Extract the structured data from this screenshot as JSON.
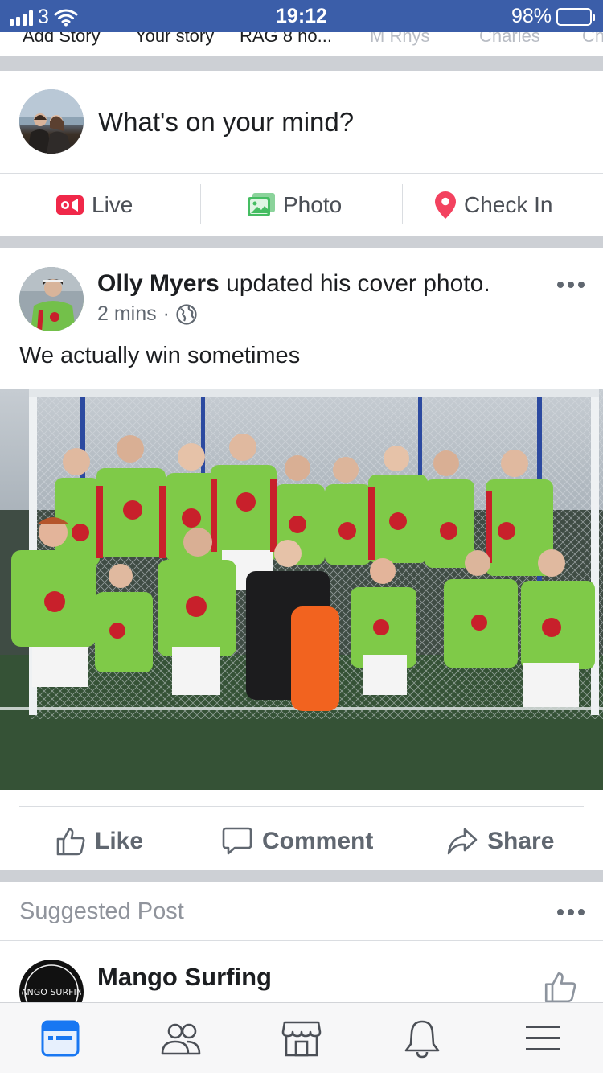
{
  "status_bar": {
    "carrier": "3",
    "time": "19:12",
    "battery": "98%"
  },
  "stories": {
    "items": [
      "Add Story",
      "Your story",
      "RAG 8 ho...",
      "M Rhys",
      "Charles",
      "Ch"
    ]
  },
  "composer": {
    "placeholder": "What's on your mind?",
    "live_label": "Live",
    "photo_label": "Photo",
    "checkin_label": "Check In"
  },
  "post": {
    "author": "Olly Myers",
    "action": "updated his cover photo.",
    "time": "2 mins",
    "separator": "·",
    "caption": "We actually win sometimes",
    "like_label": "Like",
    "comment_label": "Comment",
    "share_label": "Share"
  },
  "suggested": {
    "label": "Suggested Post",
    "page_name": "Mango Surfing",
    "logo_text": "MANGO SURFING"
  },
  "colors": {
    "brand_blue": "#3b5ea9",
    "live_red": "#f02849",
    "photo_green": "#45bd62",
    "checkin_pink": "#f3425f",
    "active_tab": "#1877f2"
  },
  "icons": {
    "tabs": [
      "news-feed-icon",
      "friends-icon",
      "marketplace-icon",
      "notifications-icon",
      "menu-icon"
    ]
  }
}
